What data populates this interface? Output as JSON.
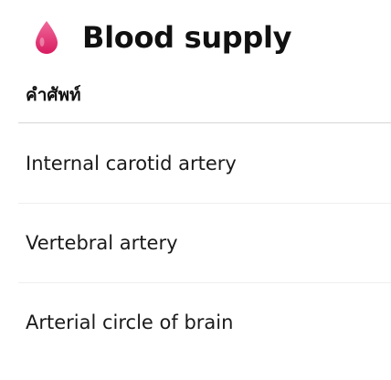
{
  "section": {
    "icon": "blood-drop-icon",
    "title": "Blood supply"
  },
  "table": {
    "column_header": "คำศัพท์",
    "rows": [
      {
        "label": "Internal carotid artery"
      },
      {
        "label": "Vertebral artery"
      },
      {
        "label": "Arterial circle of brain"
      }
    ]
  },
  "colors": {
    "drop_top": "#f06a9a",
    "drop_bottom": "#d81b60"
  }
}
